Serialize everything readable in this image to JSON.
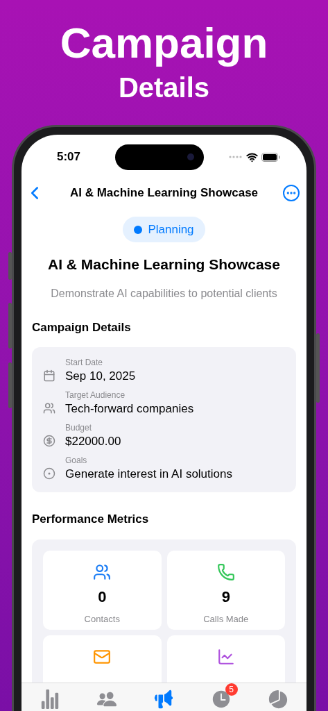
{
  "headline": {
    "title": "Campaign",
    "subtitle": "Details"
  },
  "status_bar": {
    "time": "5:07"
  },
  "nav": {
    "title": "AI & Machine Learning Showcase"
  },
  "status_badge": {
    "label": "Planning",
    "color": "#007aff"
  },
  "campaign": {
    "name": "AI & Machine Learning Showcase",
    "description": "Demonstrate AI capabilities to potential clients"
  },
  "details": {
    "heading": "Campaign Details",
    "items": [
      {
        "kind": "date",
        "label": "Start Date",
        "value": "Sep 10, 2025"
      },
      {
        "kind": "audience",
        "label": "Target Audience",
        "value": "Tech-forward companies"
      },
      {
        "kind": "budget",
        "label": "Budget",
        "value": "$22000.00"
      },
      {
        "kind": "goals",
        "label": "Goals",
        "value": "Generate interest in AI solutions"
      }
    ]
  },
  "metrics": {
    "heading": "Performance Metrics",
    "items": [
      {
        "kind": "contacts",
        "value": "0",
        "label": "Contacts"
      },
      {
        "kind": "calls",
        "value": "9",
        "label": "Calls Made"
      },
      {
        "kind": "emails"
      },
      {
        "kind": "rate"
      }
    ]
  },
  "tab_bar": [
    {
      "kind": "dashboard",
      "selected": false
    },
    {
      "kind": "contacts",
      "selected": false
    },
    {
      "kind": "campaigns",
      "selected": true
    },
    {
      "kind": "followups",
      "selected": false,
      "badge": "5"
    },
    {
      "kind": "analytics",
      "selected": false
    }
  ]
}
